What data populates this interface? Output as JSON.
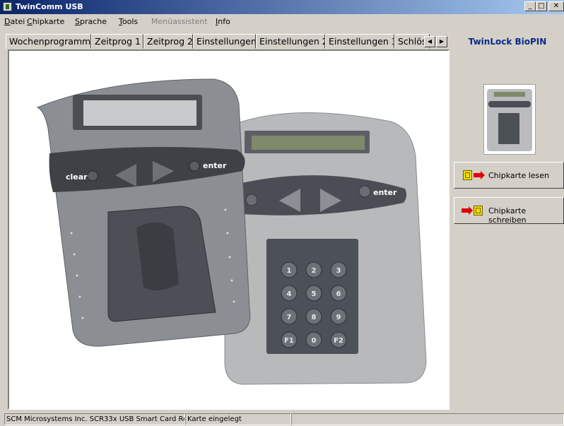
{
  "window": {
    "title": "TwinComm USB",
    "controls": {
      "minimize": "_",
      "maximize": "□",
      "close": "✕"
    }
  },
  "menu": [
    {
      "label": "Datei",
      "enabled": true
    },
    {
      "label": "Chipkarte",
      "enabled": true
    },
    {
      "label": "Sprache",
      "enabled": true
    },
    {
      "label": "Tools",
      "enabled": true
    },
    {
      "label": "Menüassistent",
      "enabled": false
    },
    {
      "label": "Info",
      "enabled": true
    }
  ],
  "tabs": [
    "Wochenprogramm",
    "Zeitprog 1",
    "Zeitprog 2",
    "Einstellungen",
    "Einstellungen 2",
    "Einstellungen 3",
    "Schlös"
  ],
  "tab_scroll": {
    "left": "◀",
    "right": "▶"
  },
  "device_image": {
    "left_keypad": {
      "clear": "clear",
      "enter": "enter"
    },
    "right_keypad": {
      "enter": "enter",
      "keys": [
        "1",
        "2",
        "3",
        "4",
        "5",
        "6",
        "7",
        "8",
        "9",
        "F1",
        "0",
        "F2"
      ]
    }
  },
  "sidebar": {
    "title": "TwinLock BioPIN",
    "read_button": "Chipkarte lesen",
    "write_button": "Chipkarte schreiben"
  },
  "status": {
    "reader": "SCM Microsystems Inc. SCR33x USB Smart Card Re",
    "card": "Karte eingelegt",
    "empty": ""
  },
  "colors": {
    "title_start": "#0a246a",
    "title_end": "#a6caf0",
    "sidebar_title": "#0a2a8a",
    "chip": "#f0e000",
    "arrow": "#e00000"
  }
}
